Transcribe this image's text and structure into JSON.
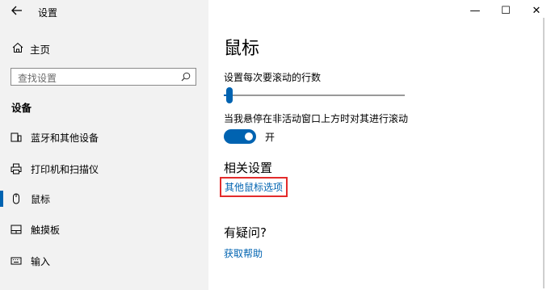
{
  "app": {
    "back_icon": "back-arrow-icon",
    "title": "设置"
  },
  "window_controls": {
    "minimize": "—",
    "maximize": "☐",
    "close": "✕"
  },
  "sidebar": {
    "home_label": "主页",
    "search_placeholder": "查找设置",
    "section_title": "设备",
    "items": [
      {
        "label": "蓝牙和其他设备",
        "icon": "bluetooth-devices-icon",
        "active": false
      },
      {
        "label": "打印机和扫描仪",
        "icon": "printer-icon",
        "active": false
      },
      {
        "label": "鼠标",
        "icon": "mouse-icon",
        "active": true
      },
      {
        "label": "触摸板",
        "icon": "touchpad-icon",
        "active": false
      },
      {
        "label": "输入",
        "icon": "keyboard-icon",
        "active": false
      }
    ]
  },
  "main": {
    "page_title": "鼠标",
    "scroll_label": "设置每次要滚动的行数",
    "scroll_lines_slider_fraction": 0.03,
    "inactive_scroll_label": "当我悬停在非活动窗口上方时对其进行滚动",
    "inactive_scroll_toggle_on": true,
    "toggle_text": "开",
    "related_title": "相关设置",
    "related_link": "其他鼠标选项",
    "question_title": "有疑问?",
    "help_link": "获取帮助"
  },
  "colors": {
    "accent": "#0063b1",
    "highlight_border": "#e32b2b",
    "sidebar_bg": "#f2f2f2"
  }
}
